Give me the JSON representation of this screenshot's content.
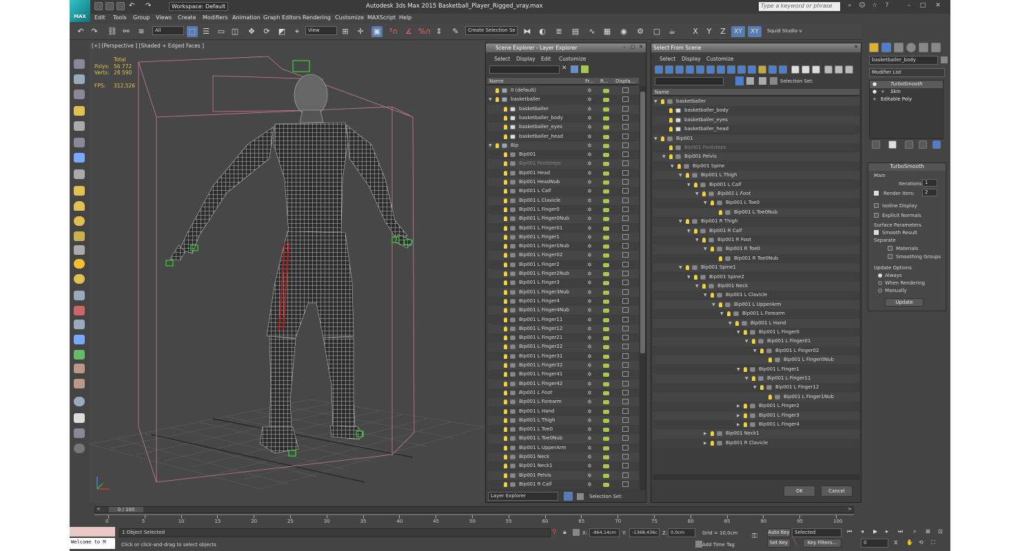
{
  "titlebar": {
    "logo": "MAX",
    "workspace": "Workspace: Default",
    "title": "Autodesk 3ds Max  2015    Basketball_Player_Rigged_vray.max",
    "search_placeholder": "Type a keyword or phrase"
  },
  "menu": [
    "Edit",
    "Tools",
    "Group",
    "Views",
    "Create",
    "Modifiers",
    "Animation",
    "Graph Editors",
    "Rendering",
    "Customize",
    "MAXScript",
    "Help"
  ],
  "toolbar": {
    "filter": "All",
    "refcoord": "View",
    "selset": "Create Selection Se",
    "axes": [
      "X",
      "Y",
      "Z",
      "XY",
      "XY"
    ],
    "studio": "Squid Studio v"
  },
  "viewport": {
    "label": "[+] [Perspective ] [Shaded + Edged Faces ]",
    "stats": {
      "total_label": "Total",
      "polys_label": "Polys:",
      "polys": "56 772",
      "verts_label": "Verts:",
      "verts": "28 590",
      "fps_label": "FPS:",
      "fps": "312,526"
    }
  },
  "scene_explorer": {
    "title": "Scene Explorer - Layer Explorer",
    "menu": [
      "Select",
      "Display",
      "Edit",
      "Customize"
    ],
    "columns": [
      "Name",
      "Fr...",
      "R...",
      "Displa..."
    ],
    "rows": [
      {
        "name": "0 (default)",
        "level": 0,
        "kind": "layer"
      },
      {
        "name": "basketballer",
        "level": 0,
        "kind": "layer",
        "exp": "open"
      },
      {
        "name": "basketballer",
        "level": 1,
        "kind": "obj"
      },
      {
        "name": "basketballer_body",
        "level": 1,
        "kind": "obj"
      },
      {
        "name": "basketballer_eyes",
        "level": 1,
        "kind": "obj"
      },
      {
        "name": "basketballer_head",
        "level": 1,
        "kind": "obj"
      },
      {
        "name": "Bip",
        "level": 0,
        "kind": "layer",
        "exp": "open"
      },
      {
        "name": "Bip001",
        "level": 1,
        "kind": "bone"
      },
      {
        "name": "Bip001 Footsteps",
        "level": 1,
        "kind": "bone",
        "dim": true
      },
      {
        "name": "Bip001 Head",
        "level": 1,
        "kind": "bone"
      },
      {
        "name": "Bip001 HeadNub",
        "level": 1,
        "kind": "bone"
      },
      {
        "name": "Bip001 L Calf",
        "level": 1,
        "kind": "bone"
      },
      {
        "name": "Bip001 L Clavicle",
        "level": 1,
        "kind": "bone"
      },
      {
        "name": "Bip001 L Finger0",
        "level": 1,
        "kind": "bone"
      },
      {
        "name": "Bip001 L Finger0Nub",
        "level": 1,
        "kind": "bone"
      },
      {
        "name": "Bip001 L Finger01",
        "level": 1,
        "kind": "bone"
      },
      {
        "name": "Bip001 L Finger1",
        "level": 1,
        "kind": "bone"
      },
      {
        "name": "Bip001 L Finger1Nub",
        "level": 1,
        "kind": "bone"
      },
      {
        "name": "Bip001 L Finger02",
        "level": 1,
        "kind": "bone"
      },
      {
        "name": "Bip001 L Finger2",
        "level": 1,
        "kind": "bone"
      },
      {
        "name": "Bip001 L Finger2Nub",
        "level": 1,
        "kind": "bone"
      },
      {
        "name": "Bip001 L Finger3",
        "level": 1,
        "kind": "bone"
      },
      {
        "name": "Bip001 L Finger3Nub",
        "level": 1,
        "kind": "bone"
      },
      {
        "name": "Bip001 L Finger4",
        "level": 1,
        "kind": "bone"
      },
      {
        "name": "Bip001 L Finger4Nub",
        "level": 1,
        "kind": "bone"
      },
      {
        "name": "Bip001 L Finger11",
        "level": 1,
        "kind": "bone"
      },
      {
        "name": "Bip001 L Finger12",
        "level": 1,
        "kind": "bone"
      },
      {
        "name": "Bip001 L Finger21",
        "level": 1,
        "kind": "bone"
      },
      {
        "name": "Bip001 L Finger22",
        "level": 1,
        "kind": "bone"
      },
      {
        "name": "Bip001 L Finger31",
        "level": 1,
        "kind": "bone"
      },
      {
        "name": "Bip001 L Finger32",
        "level": 1,
        "kind": "bone"
      },
      {
        "name": "Bip001 L Finger41",
        "level": 1,
        "kind": "bone"
      },
      {
        "name": "Bip001 L Finger42",
        "level": 1,
        "kind": "bone"
      },
      {
        "name": "Bip001 L Foot",
        "level": 1,
        "kind": "bone",
        "italic": true
      },
      {
        "name": "Bip001 L Forearm",
        "level": 1,
        "kind": "bone"
      },
      {
        "name": "Bip001 L Hand",
        "level": 1,
        "kind": "bone"
      },
      {
        "name": "Bip001 L Thigh",
        "level": 1,
        "kind": "bone"
      },
      {
        "name": "Bip001 L Toe0",
        "level": 1,
        "kind": "bone"
      },
      {
        "name": "Bip001 L Toe0Nub",
        "level": 1,
        "kind": "bone"
      },
      {
        "name": "Bip001 L UpperArm",
        "level": 1,
        "kind": "bone"
      },
      {
        "name": "Bip001 Neck",
        "level": 1,
        "kind": "bone"
      },
      {
        "name": "Bip001 Neck1",
        "level": 1,
        "kind": "bone"
      },
      {
        "name": "Bip001 Pelvis",
        "level": 1,
        "kind": "bone"
      },
      {
        "name": "Bip001 R Calf",
        "level": 1,
        "kind": "bone"
      }
    ],
    "footer_combo": "Layer Explorer",
    "footer_selset": "Selection Set:"
  },
  "select_from_scene": {
    "title": "Select From Scene",
    "menu": [
      "Select",
      "Display",
      "Customize"
    ],
    "selset_label": "Selection Set:",
    "col_name": "Name",
    "rows": [
      {
        "name": "basketballer",
        "level": 0,
        "exp": "open"
      },
      {
        "name": "basketballer_body",
        "level": 1
      },
      {
        "name": "basketballer_eyes",
        "level": 1
      },
      {
        "name": "basketballer_head",
        "level": 1
      },
      {
        "name": "Bip001",
        "level": 0,
        "exp": "open"
      },
      {
        "name": "Bip001 Footsteps",
        "level": 1,
        "dim": true
      },
      {
        "name": "Bip001 Pelvis",
        "level": 1,
        "exp": "open"
      },
      {
        "name": "Bip001 Spine",
        "level": 2,
        "exp": "open"
      },
      {
        "name": "Bip001 L Thigh",
        "level": 3,
        "exp": "open"
      },
      {
        "name": "Bip001 L Calf",
        "level": 4,
        "exp": "open"
      },
      {
        "name": "Bip001 L Foot",
        "level": 5,
        "exp": "open",
        "italic": true
      },
      {
        "name": "Bip001 L Toe0",
        "level": 6,
        "exp": "open"
      },
      {
        "name": "Bip001 L Toe0Nub",
        "level": 7
      },
      {
        "name": "Bip001 R Thigh",
        "level": 3,
        "exp": "open"
      },
      {
        "name": "Bip001 R Calf",
        "level": 4,
        "exp": "open"
      },
      {
        "name": "Bip001 R Foot",
        "level": 5,
        "exp": "open"
      },
      {
        "name": "Bip001 R Toe0",
        "level": 6,
        "exp": "open"
      },
      {
        "name": "Bip001 R Toe0Nub",
        "level": 7
      },
      {
        "name": "Bip001 Spine1",
        "level": 3,
        "exp": "open"
      },
      {
        "name": "Bip001 Spine2",
        "level": 4,
        "exp": "open"
      },
      {
        "name": "Bip001 Neck",
        "level": 5,
        "exp": "open"
      },
      {
        "name": "Bip001 L Clavicle",
        "level": 6,
        "exp": "open"
      },
      {
        "name": "Bip001 L UpperArm",
        "level": 7,
        "exp": "open"
      },
      {
        "name": "Bip001 L Forearm",
        "level": 8,
        "exp": "open"
      },
      {
        "name": "Bip001 L Hand",
        "level": 9,
        "exp": "open"
      },
      {
        "name": "Bip001 L Finger0",
        "level": 10,
        "exp": "open"
      },
      {
        "name": "Bip001 L Finger01",
        "level": 11,
        "exp": "open"
      },
      {
        "name": "Bip001 L Finger02",
        "level": 12,
        "exp": "open"
      },
      {
        "name": "Bip001 L Finger0Nub",
        "level": 13
      },
      {
        "name": "Bip001 L Finger1",
        "level": 10,
        "exp": "open"
      },
      {
        "name": "Bip001 L Finger11",
        "level": 11,
        "exp": "open"
      },
      {
        "name": "Bip001 L Finger12",
        "level": 12,
        "exp": "open"
      },
      {
        "name": "Bip001 L Finger1Nub",
        "level": 13
      },
      {
        "name": "Bip001 L Finger2",
        "level": 10,
        "exp": "closed"
      },
      {
        "name": "Bip001 L Finger3",
        "level": 10,
        "exp": "closed"
      },
      {
        "name": "Bip001 L Finger4",
        "level": 10,
        "exp": "closed"
      },
      {
        "name": "Bip001 Neck1",
        "level": 6,
        "exp": "closed"
      },
      {
        "name": "Bip001 R Clavicle",
        "level": 6,
        "exp": "closed"
      }
    ],
    "ok": "OK",
    "cancel": "Cancel"
  },
  "command_panel": {
    "object_name": "basketballer_body",
    "modifier_list": "Modifier List",
    "stack": [
      "TurboSmooth",
      "Skin",
      "Editable Poly"
    ],
    "rollout_title": "TurboSmooth",
    "main_label": "Main",
    "iterations_label": "Iterations:",
    "iterations": "1",
    "render_iters_label": "Render Iters:",
    "render_iters": "2",
    "isoline": "Isoline Display",
    "explicit": "Explicit Normals",
    "surface_params": "Surface Parameters",
    "smooth_result": "Smooth Result",
    "separate": "Separate",
    "materials": "Materials",
    "smoothing_groups": "Smoothing Groups",
    "update_options": "Update Options",
    "always": "Always",
    "when_rendering": "When Rendering",
    "manually": "Manually",
    "update": "Update"
  },
  "timeline": {
    "frame": "0 / 100",
    "ticks": [
      "0",
      "5",
      "10",
      "15",
      "20",
      "25",
      "30",
      "35",
      "40",
      "45",
      "50",
      "55",
      "60",
      "65",
      "70",
      "75",
      "80",
      "85",
      "90",
      "95",
      "100"
    ]
  },
  "status": {
    "listener": "Welcome to M",
    "selected": "1 Object Selected",
    "prompt": "Click or click-and-drag to select objects",
    "x_label": "X:",
    "x": "-964,14cm",
    "y_label": "Y:",
    "y": "-1368,436c",
    "z_label": "Z:",
    "z": "0,0cm",
    "grid": "Grid = 10,0cm",
    "add_time_tag": "Add Time Tag",
    "auto_key": "Auto Key",
    "set_key": "Set Key",
    "key_mode": "Selected",
    "key_filters": "Key Filters...",
    "frame_field": "0"
  }
}
